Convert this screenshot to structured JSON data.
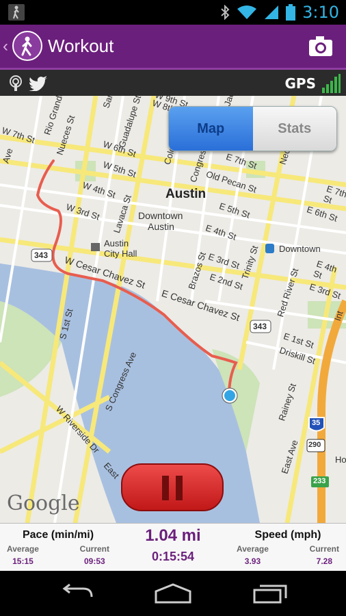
{
  "status_bar": {
    "time": "3:10"
  },
  "action_bar": {
    "title": "Workout",
    "back_glyph": "‹"
  },
  "toolbar2": {
    "gps_label": "GPS"
  },
  "map": {
    "segment": {
      "map_label": "Map",
      "stats_label": "Stats",
      "selected": "Map"
    },
    "labels": {
      "city": "Austin",
      "downtown1": "Downtown",
      "downtown2": "Austin",
      "cityhall1": "Austin",
      "cityhall2": "City Hall",
      "downtown_station": "Downtown",
      "w9th": "W 9th St",
      "w8th": "W 8th St",
      "w7th": "W 7th St",
      "w6th": "W 6th St",
      "w5th": "W 5th St",
      "w4th": "W 4th St",
      "w3rd": "W 3rd St",
      "e7th": "E 7th St",
      "e6th": "E 6th St",
      "e5th": "E 5th St",
      "e4th": "E 4th St",
      "e3rd": "E 3rd St",
      "e2nd": "E 2nd St",
      "e1st": "E 1st St",
      "e4th_b": "E 4th St",
      "e3rd_b": "E 3rd St",
      "e7th_b": "E 7th St",
      "e6th_b": "E 6th St",
      "wcesar": "W Cesar Chavez St",
      "ecesar": "E Cesar Chavez St",
      "oldpecan": "Old Pecan St",
      "riogrande": "Rio Grande St",
      "nueces": "Nueces St",
      "guadalupe": "Guadalupe St",
      "lavaca": "Lavaca St",
      "colorado": "Colorado St",
      "congress": "Congress Ave",
      "brazos": "Brazos St",
      "sanjac": "San Jacinto",
      "trinity": "Trinity St",
      "neches": "Neches St",
      "redriver": "Red River St",
      "s1st": "S 1st St",
      "scongress": "S Congress Ave",
      "wriverside": "W Riverside Dr",
      "east": "East",
      "eastave": "East Ave",
      "rainey": "Rainey St",
      "driskill": "Driskill St",
      "sanan": "San An",
      "ave": "Ave",
      "ho": "Ho",
      "int": "Int",
      "rbox1": "343",
      "rbox2": "343",
      "shield35": "35",
      "shield290": "290",
      "shield233": "233"
    },
    "google_logo": "Google",
    "accent_route": "#e85d4e"
  },
  "stats": {
    "pace_header": "Pace (min/mi)",
    "pace_avg_label": "Average",
    "pace_avg_value": "15:15",
    "pace_cur_label": "Current",
    "pace_cur_value": "09:53",
    "distance": "1.04 mi",
    "elapsed": "0:15:54",
    "speed_header": "Speed (mph)",
    "speed_avg_label": "Average",
    "speed_avg_value": "3.93",
    "speed_cur_label": "Current",
    "speed_cur_value": "7.28"
  },
  "colors": {
    "brand": "#6b1f7c",
    "status_blue": "#33b5e5",
    "pause_red": "#d92a2a"
  },
  "icons": [
    "walker-icon",
    "bluetooth-icon",
    "wifi-icon",
    "signal-icon",
    "battery-icon",
    "app-walker-icon",
    "camera-icon",
    "podcast-icon",
    "twitter-icon",
    "signal-bars-icon",
    "location-dot-icon",
    "pause-icon",
    "nav-back-icon",
    "nav-home-icon",
    "nav-recents-icon"
  ]
}
